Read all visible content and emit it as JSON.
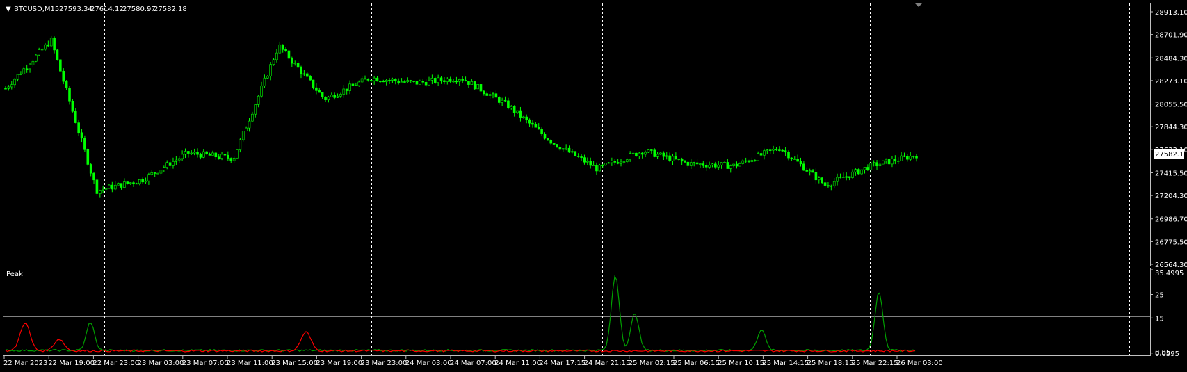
{
  "chart_header": {
    "symbol": "BTCUSD,M15",
    "open": "27593.34",
    "high": "27614.12",
    "low": "27580.97",
    "close": "27582.18"
  },
  "colors": {
    "background": "#000000",
    "candles": "#00ff00",
    "grid": "#c0c0c0",
    "peak_green": "#00a000",
    "peak_red": "#ff0000"
  },
  "price_axis": {
    "ticks": [
      "28913.10",
      "28701.90",
      "28484.30",
      "28273.10",
      "28055.50",
      "27844.30",
      "27633.10",
      "27415.50",
      "27204.30",
      "26986.70",
      "26775.50",
      "26564.30"
    ],
    "current_price_label": "27582.18"
  },
  "indicator": {
    "name": "Peak",
    "axis_ticks": [
      "35.4995",
      "25",
      "15",
      "0.0595"
    ],
    "overlay_tick": "0.05"
  },
  "time_axis": {
    "labels": [
      "22 Mar 2023",
      "22 Mar 19:00",
      "22 Mar 23:00",
      "23 Mar 03:00",
      "23 Mar 07:00",
      "23 Mar 11:00",
      "23 Mar 15:00",
      "23 Mar 19:00",
      "23 Mar 23:00",
      "24 Mar 03:00",
      "24 Mar 07:00",
      "24 Mar 11:00",
      "24 Mar 17:15",
      "24 Mar 21:15",
      "25 Mar 02:15",
      "25 Mar 06:15",
      "25 Mar 10:15",
      "25 Mar 14:15",
      "25 Mar 18:15",
      "25 Mar 22:15",
      "26 Mar 03:00"
    ]
  },
  "chart_data": {
    "type": "candlestick",
    "price_ylim": [
      26564.3,
      28913.1
    ],
    "indicator_ylim": [
      0,
      35.4995
    ],
    "grid": "period separators (dashed vertical)",
    "key_points": [
      {
        "t": "22 Mar 2023",
        "price": 28200
      },
      {
        "t": "22 Mar 19:00",
        "price": 28650
      },
      {
        "t": "22 Mar 23:00",
        "price": 27250
      },
      {
        "t": "23 Mar 03:00",
        "price": 27350
      },
      {
        "t": "23 Mar 07:00",
        "price": 27600
      },
      {
        "t": "23 Mar 11:00",
        "price": 27550
      },
      {
        "t": "23 Mar 15:00",
        "price": 28600
      },
      {
        "t": "23 Mar 19:00",
        "price": 28100
      },
      {
        "t": "23 Mar 23:00",
        "price": 28300
      },
      {
        "t": "24 Mar 03:00",
        "price": 28250
      },
      {
        "t": "24 Mar 07:00",
        "price": 28300
      },
      {
        "t": "24 Mar 11:00",
        "price": 28050
      },
      {
        "t": "24 Mar 17:15",
        "price": 27700
      },
      {
        "t": "24 Mar 21:15",
        "price": 27450
      },
      {
        "t": "25 Mar 02:15",
        "price": 27620
      },
      {
        "t": "25 Mar 06:15",
        "price": 27500
      },
      {
        "t": "25 Mar 10:15",
        "price": 27480
      },
      {
        "t": "25 Mar 14:15",
        "price": 27650
      },
      {
        "t": "25 Mar 18:15",
        "price": 27300
      },
      {
        "t": "25 Mar 22:15",
        "price": 27480
      },
      {
        "t": "26 Mar 03:00",
        "price": 27582
      }
    ]
  }
}
